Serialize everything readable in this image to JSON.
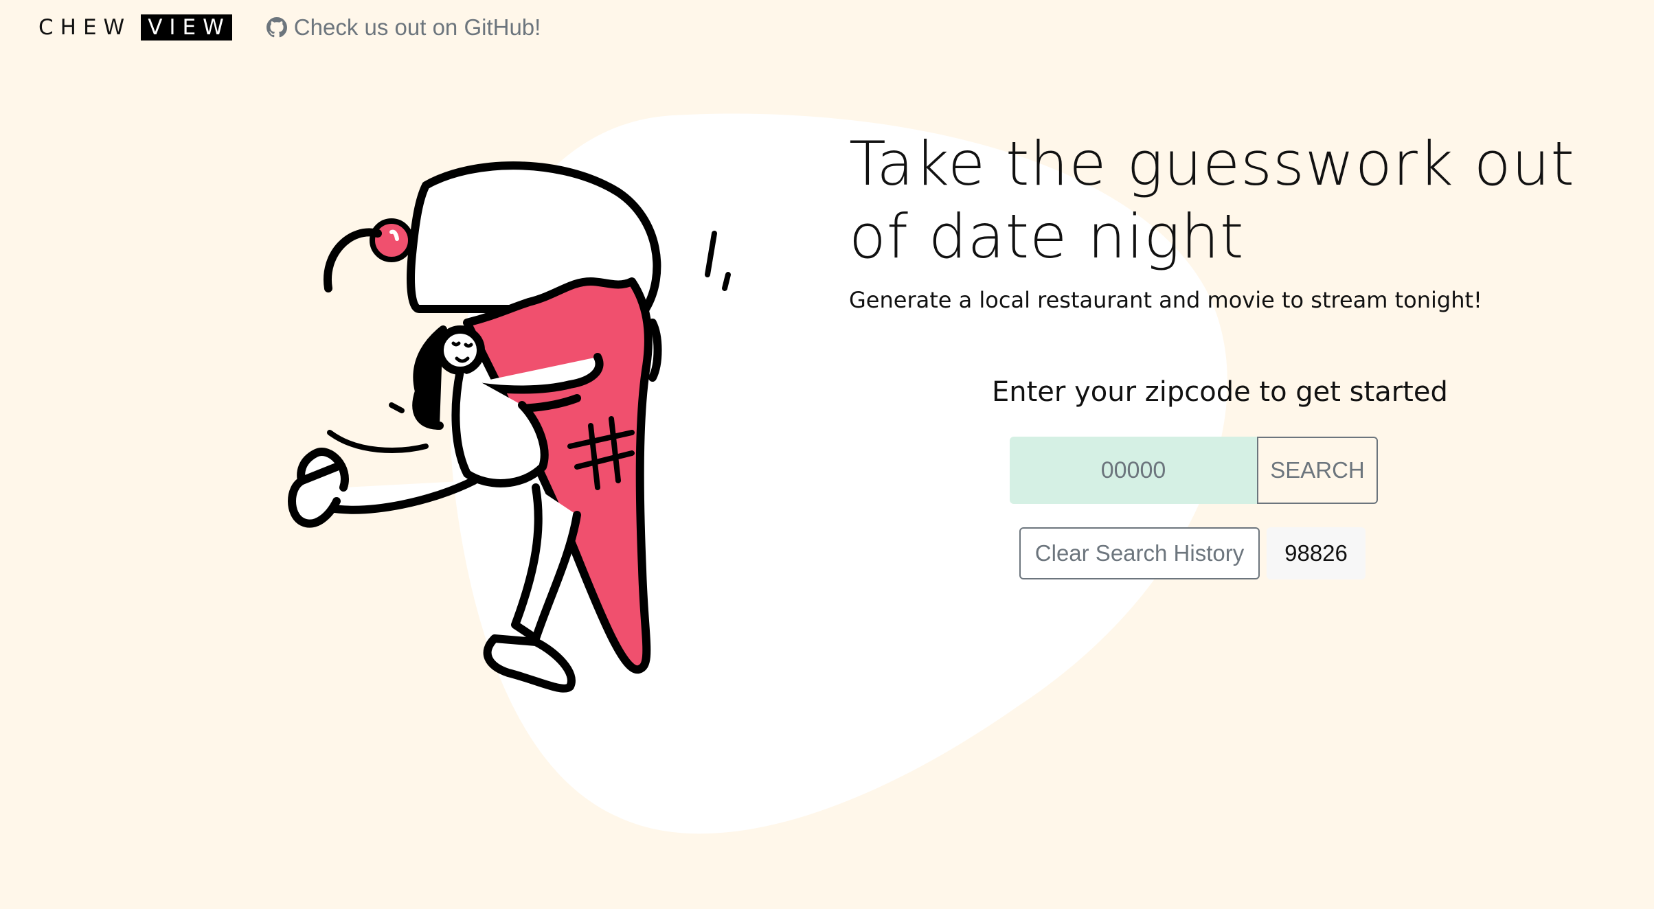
{
  "header": {
    "logo_part1": "CHEW",
    "logo_part2": "VIEW",
    "github_link": "Check us out on GitHub!",
    "github_icon": "github-icon"
  },
  "hero": {
    "title": "Take the guesswork out of date night",
    "subtitle": "Generate a local restaurant and movie to stream tonight!",
    "illustration": "girl-hugging-ice-cream-cone"
  },
  "search": {
    "prompt": "Enter your zipcode to get started",
    "placeholder": "00000",
    "button_label": "SEARCH"
  },
  "history": {
    "clear_label": "Clear Search History",
    "items": [
      "98826"
    ]
  },
  "colors": {
    "background": "#fff7ea",
    "blob": "#ffffff",
    "input_bg": "#d5f0e4",
    "cone": "#f0506e",
    "muted": "#6c757d"
  }
}
